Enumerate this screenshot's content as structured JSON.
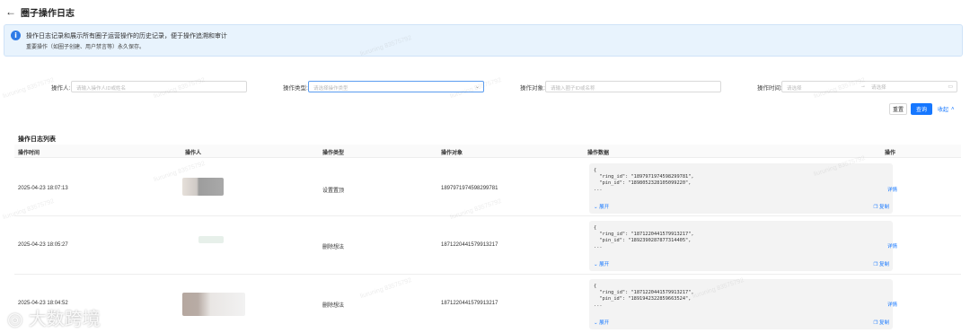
{
  "header": {
    "title": "圈子操作日志"
  },
  "alert": {
    "line1": "操作日志记录和展示所有圈子运营操作的历史记录，便于操作追溯和审计",
    "line2": "重要操作（如圈子创建、用户禁言等）永久保存。"
  },
  "filters": {
    "operator": {
      "label": "操作人:",
      "placeholder": "请输入操作人ID或姓名"
    },
    "op_type": {
      "label": "操作类型:",
      "placeholder": "请选择操作类型"
    },
    "op_target": {
      "label": "操作对象:",
      "placeholder": "请输入圈子ID或名称"
    },
    "op_time": {
      "label": "操作时间:",
      "start": "请选择",
      "end": "请选择"
    }
  },
  "buttons": {
    "reset": "重置",
    "query": "查询",
    "collapse": "收起"
  },
  "list": {
    "title": "操作日志列表",
    "columns": [
      "操作时间",
      "操作人",
      "操作类型",
      "操作对象",
      "操作数据",
      "操作"
    ],
    "rows": [
      {
        "time": "2025-04-23 18:07:13",
        "type": "设置置顶",
        "target": "1897971974598299781",
        "code": "{\n  \"ring_id\": \"1897971974598299781\",\n  \"pin_id\": \"1898052328105099220\",\n...",
        "expand": "展开",
        "copy": "复制",
        "action": "详情"
      },
      {
        "time": "2025-04-23 18:05:27",
        "type": "删除想法",
        "target": "1871220441579913217",
        "code": "{\n  \"ring_id\": \"1871220441579913217\",\n  \"pin_id\": \"1892390287877314405\",\n...",
        "expand": "展开",
        "copy": "复制",
        "action": "详情"
      },
      {
        "time": "2025-04-23 18:04:52",
        "type": "删除想法",
        "target": "1871220441579913217",
        "code": "{\n  \"ring_id\": \"1871220441579913217\",\n  \"pin_id\": \"1891942322859663524\",\n...",
        "expand": "展开",
        "copy": "复制",
        "action": "详情"
      }
    ]
  },
  "watermark": {
    "text": "liuruning 83575792"
  },
  "brand": {
    "text": "大数跨境"
  },
  "colors": {
    "primary": "#1677ff",
    "alert_bg": "#e8f3fd",
    "info": "#2f7be6"
  }
}
